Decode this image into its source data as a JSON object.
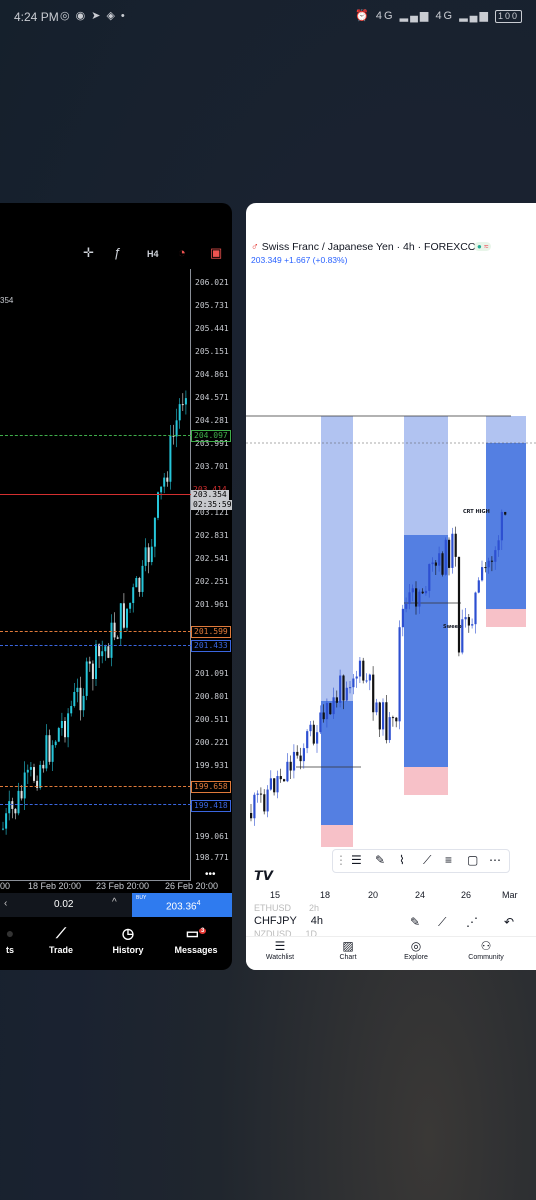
{
  "status_bar": {
    "time": "4:24 PM",
    "left_icons": [
      "messenger-icon",
      "whatsapp-icon",
      "telegram-icon",
      "gps-icon",
      "dot-icon"
    ],
    "right_icons": [
      "alarm-icon",
      "signal-icon",
      "wifi-icon"
    ],
    "network_1": "4G",
    "network_2": "4G",
    "battery": "100"
  },
  "left_app": {
    "timeframe": "H4",
    "price_scale": [
      "206.021",
      "205.731",
      "205.441",
      "205.151",
      "204.861",
      "204.571",
      "204.281",
      "203.991",
      "203.701",
      "203.121",
      "202.831",
      "202.541",
      "202.251",
      "201.961",
      "201.091",
      "200.801",
      "200.511",
      "200.221",
      "199.931",
      "199.351",
      "199.061",
      "198.771"
    ],
    "tags": {
      "tp": "204.097",
      "bid_top": "203.414",
      "bid": "203.354",
      "countdown": "02:35:59",
      "entry": "201.599",
      "entry2": "201.671",
      "sell": "201.433",
      "sell2": "201.381",
      "sl": "199.658",
      "sl2": "199.418",
      "sl3": "199.351"
    },
    "partial_label": "354",
    "x_labels": [
      "00",
      "18 Feb 20:00",
      "23 Feb 20:00",
      "26 Feb 20:00"
    ],
    "lot": "0.02",
    "buy_label": "BUY",
    "buy_price_main": "203.36",
    "buy_price_sup": "4",
    "nav": [
      {
        "label": "ts",
        "icon": "circle-icon"
      },
      {
        "label": "Trade",
        "icon": "trade-icon"
      },
      {
        "label": "History",
        "icon": "history-icon"
      },
      {
        "label": "Messages",
        "icon": "messages-icon",
        "badge": "3"
      }
    ],
    "more_label": "•••"
  },
  "right_app": {
    "title": "Swiss Franc / Japanese Yen · 4h · FOREXCOM",
    "price_change": "203.349  +1.667 (+0.83%)",
    "annotations": {
      "crt_high": "CRT HIGH",
      "sweep": "Sweep"
    },
    "x_axis": [
      "15",
      "18",
      "20",
      "24",
      "26",
      "Mar"
    ],
    "watchlist_rows": [
      {
        "symbol": "ETHUSD",
        "tf": "2h"
      },
      {
        "symbol": "CHFJPY",
        "tf": "4h"
      },
      {
        "symbol": "NZDUSD",
        "tf": "1D"
      }
    ],
    "nav": [
      {
        "label": "Watchlist",
        "icon": "list-icon"
      },
      {
        "label": "Chart",
        "icon": "chart-icon"
      },
      {
        "label": "Explore",
        "icon": "compass-icon"
      },
      {
        "label": "Community",
        "icon": "people-icon"
      }
    ],
    "colors": {
      "bull": "#3d5fd6",
      "box_light": "#a8bdf0",
      "box_dark": "#4a78e0",
      "pink": "#f7c1c8"
    }
  }
}
